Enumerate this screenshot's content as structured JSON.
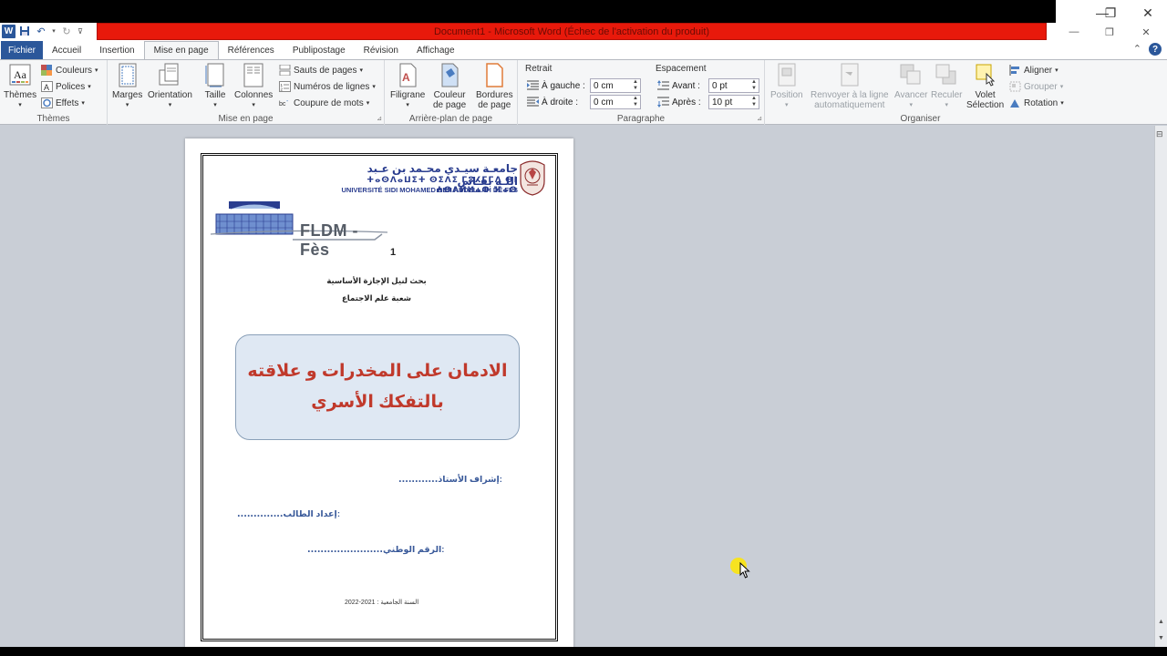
{
  "window": {
    "title": "Document1 - Microsoft Word (Échec de l'activation du produit)",
    "controls": [
      "–",
      "❐",
      "✕"
    ]
  },
  "tabs": [
    {
      "label": "Fichier"
    },
    {
      "label": "Accueil"
    },
    {
      "label": "Insertion"
    },
    {
      "label": "Mise en page"
    },
    {
      "label": "Références"
    },
    {
      "label": "Publipostage"
    },
    {
      "label": "Révision"
    },
    {
      "label": "Affichage"
    }
  ],
  "ribbon": {
    "themes": {
      "group": "Thèmes",
      "themes_btn": "Thèmes",
      "colors": "Couleurs",
      "fonts": "Polices",
      "effects": "Effets"
    },
    "page_setup": {
      "group": "Mise en page",
      "margins": "Marges",
      "orientation": "Orientation",
      "size": "Taille",
      "columns": "Colonnes",
      "breaks": "Sauts de pages",
      "line_numbers": "Numéros de lignes",
      "hyphenation": "Coupure de mots"
    },
    "page_background": {
      "group": "Arrière-plan de page",
      "watermark": "Filigrane",
      "page_color_1": "Couleur",
      "page_color_2": "de page",
      "borders_1": "Bordures",
      "borders_2": "de page"
    },
    "paragraph": {
      "group": "Paragraphe",
      "indent_title": "Retrait",
      "left_label": "À gauche :",
      "left_value": "0 cm",
      "right_label": "À droite :",
      "right_value": "0 cm",
      "spacing_title": "Espacement",
      "before_label": "Avant :",
      "before_value": "0  pt",
      "after_label": "Après :",
      "after_value": "10  pt"
    },
    "arrange": {
      "group": "Organiser",
      "position": "Position",
      "wrap_1": "Renvoyer à la ligne",
      "wrap_2": "automatiquement",
      "forward": "Avancer",
      "backward": "Reculer",
      "selection_1": "Volet",
      "selection_2": "Sélection",
      "align": "Aligner",
      "group_btn": "Grouper",
      "rotate": "Rotation"
    }
  },
  "document": {
    "univ_ar": "جامعـة سيـدي محـمد بن عـبد اللـه بفـاس",
    "univ_tif": "ⵜⴰⵙⴷⴰⵡⵉⵜ ⵙⵉⴷⵉ ⵎⵓⵃⵎⵎⴷ ⴱⵏ ⵄⴱⴷⵍⵍⴰⵀ ⴼⴰⵙ",
    "univ_fr": "UNIVERSITÉ SIDI MOHAMED BEN ABDELLAH DE FES",
    "faculty_logo_text": "FLDM - Fès",
    "page_number": "1",
    "subtitle1": "بحث لنيل الإجازة الأساسية",
    "subtitle2": "شعبة علم الاجتماع",
    "title_line1": "الادمان على المخدرات و علاقته",
    "title_line2": "بالتفكك الأسري",
    "supervisor": "إشراف الأستاذ:",
    "supervisor_dots": "............",
    "student": "إعداد الطالب:",
    "student_dots": "..............",
    "national_id": "الرقم الوطني:",
    "national_id_dots": ".......................",
    "academic_year": "السنة الجامعية : 2021-2022"
  }
}
